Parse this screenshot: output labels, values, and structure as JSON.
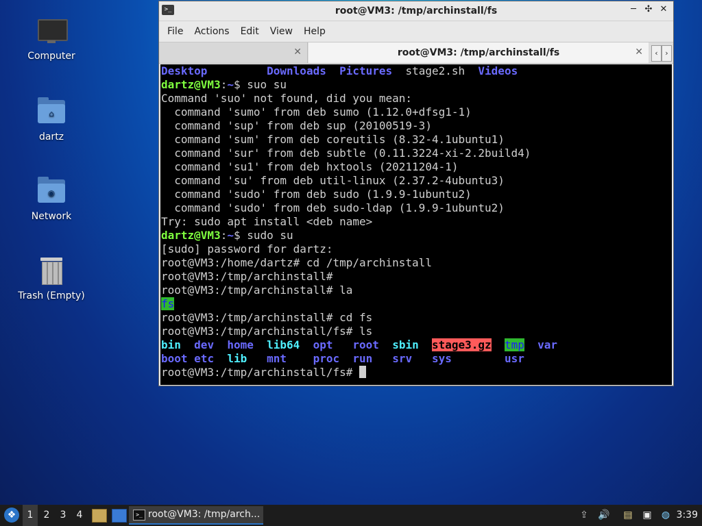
{
  "desktop": {
    "icons": [
      {
        "label": "Computer"
      },
      {
        "label": "dartz"
      },
      {
        "label": "Network"
      },
      {
        "label": "Trash (Empty)"
      }
    ]
  },
  "window": {
    "title": "root@VM3: /tmp/archinstall/fs",
    "controls": {
      "minimize": "─",
      "restore": "✣",
      "close": "✕"
    },
    "menu": [
      "File",
      "Actions",
      "Edit",
      "View",
      "Help"
    ],
    "tabs": [
      {
        "label": ""
      },
      {
        "label": "root@VM3: /tmp/archinstall/fs"
      }
    ],
    "tab_close": "✕",
    "nav_prev": "‹",
    "nav_next": "›"
  },
  "terminal": {
    "lines": [
      [
        {
          "t": "Desktop",
          "c": "c-blue"
        },
        {
          "t": "         ",
          "c": "c-plain"
        },
        {
          "t": "Downloads",
          "c": "c-blue"
        },
        {
          "t": "  ",
          "c": "c-plain"
        },
        {
          "t": "Pictures",
          "c": "c-blue"
        },
        {
          "t": "  stage2.sh  ",
          "c": "c-plain"
        },
        {
          "t": "Videos",
          "c": "c-blue"
        }
      ],
      [
        {
          "t": "dartz@VM3",
          "c": "c-green"
        },
        {
          "t": ":",
          "c": "c-plain"
        },
        {
          "t": "~",
          "c": "c-blue"
        },
        {
          "t": "$ suo su",
          "c": "c-plain"
        }
      ],
      [
        {
          "t": "Command 'suo' not found, did you mean:",
          "c": "c-plain"
        }
      ],
      [
        {
          "t": "  command 'sumo' from deb sumo (1.12.0+dfsg1-1)",
          "c": "c-plain"
        }
      ],
      [
        {
          "t": "  command 'sup' from deb sup (20100519-3)",
          "c": "c-plain"
        }
      ],
      [
        {
          "t": "  command 'sum' from deb coreutils (8.32-4.1ubuntu1)",
          "c": "c-plain"
        }
      ],
      [
        {
          "t": "  command 'sur' from deb subtle (0.11.3224-xi-2.2build4)",
          "c": "c-plain"
        }
      ],
      [
        {
          "t": "  command 'su1' from deb hxtools (20211204-1)",
          "c": "c-plain"
        }
      ],
      [
        {
          "t": "  command 'su' from deb util-linux (2.37.2-4ubuntu3)",
          "c": "c-plain"
        }
      ],
      [
        {
          "t": "  command 'sudo' from deb sudo (1.9.9-1ubuntu2)",
          "c": "c-plain"
        }
      ],
      [
        {
          "t": "  command 'sudo' from deb sudo-ldap (1.9.9-1ubuntu2)",
          "c": "c-plain"
        }
      ],
      [
        {
          "t": "Try: sudo apt install <deb name>",
          "c": "c-plain"
        }
      ],
      [
        {
          "t": "dartz@VM3",
          "c": "c-green"
        },
        {
          "t": ":",
          "c": "c-plain"
        },
        {
          "t": "~",
          "c": "c-blue"
        },
        {
          "t": "$ sudo su",
          "c": "c-plain"
        }
      ],
      [
        {
          "t": "[sudo] password for dartz:",
          "c": "c-plain"
        }
      ],
      [
        {
          "t": "root@VM3:/home/dartz# cd /tmp/archinstall",
          "c": "c-plain"
        }
      ],
      [
        {
          "t": "root@VM3:/tmp/archinstall#",
          "c": "c-plain"
        }
      ],
      [
        {
          "t": "root@VM3:/tmp/archinstall# la",
          "c": "c-plain"
        }
      ],
      [
        {
          "t": "fs",
          "c": "c-hl-green"
        }
      ],
      [
        {
          "t": "root@VM3:/tmp/archinstall# cd fs",
          "c": "c-plain"
        }
      ],
      [
        {
          "t": "root@VM3:/tmp/archinstall/fs# ls",
          "c": "c-plain"
        }
      ],
      [
        {
          "t": "bin",
          "c": "c-cyan"
        },
        {
          "t": "  ",
          "c": "c-plain"
        },
        {
          "t": "dev",
          "c": "c-blue"
        },
        {
          "t": "  ",
          "c": "c-plain"
        },
        {
          "t": "home",
          "c": "c-blue"
        },
        {
          "t": "  ",
          "c": "c-plain"
        },
        {
          "t": "lib64",
          "c": "c-cyan"
        },
        {
          "t": "  ",
          "c": "c-plain"
        },
        {
          "t": "opt",
          "c": "c-blue"
        },
        {
          "t": "   ",
          "c": "c-plain"
        },
        {
          "t": "root",
          "c": "c-blue"
        },
        {
          "t": "  ",
          "c": "c-plain"
        },
        {
          "t": "sbin",
          "c": "c-cyan"
        },
        {
          "t": "  ",
          "c": "c-plain"
        },
        {
          "t": "stage3.gz",
          "c": "c-hl-red"
        },
        {
          "t": "  ",
          "c": "c-plain"
        },
        {
          "t": "tmp",
          "c": "c-hl-green"
        },
        {
          "t": "  ",
          "c": "c-plain"
        },
        {
          "t": "var",
          "c": "c-blue"
        }
      ],
      [
        {
          "t": "boot",
          "c": "c-blue"
        },
        {
          "t": " ",
          "c": "c-plain"
        },
        {
          "t": "etc",
          "c": "c-blue"
        },
        {
          "t": "  ",
          "c": "c-plain"
        },
        {
          "t": "lib",
          "c": "c-cyan"
        },
        {
          "t": "   ",
          "c": "c-plain"
        },
        {
          "t": "mnt",
          "c": "c-blue"
        },
        {
          "t": "    ",
          "c": "c-plain"
        },
        {
          "t": "proc",
          "c": "c-blue"
        },
        {
          "t": "  ",
          "c": "c-plain"
        },
        {
          "t": "run",
          "c": "c-blue"
        },
        {
          "t": "   ",
          "c": "c-plain"
        },
        {
          "t": "srv",
          "c": "c-blue"
        },
        {
          "t": "   ",
          "c": "c-plain"
        },
        {
          "t": "sys",
          "c": "c-blue"
        },
        {
          "t": "        ",
          "c": "c-plain"
        },
        {
          "t": "usr",
          "c": "c-blue"
        }
      ],
      [
        {
          "t": "root@VM3:/tmp/archinstall/fs# ",
          "c": "c-plain"
        }
      ]
    ]
  },
  "taskbar": {
    "workspaces": [
      "1",
      "2",
      "3",
      "4"
    ],
    "active_workspace": "1",
    "task_label": "root@VM3: /tmp/arch...",
    "clock": "3:39",
    "tray_icons": [
      "upload-icon",
      "volume-icon",
      "clipboard-icon",
      "network-icon",
      "update-icon"
    ]
  }
}
